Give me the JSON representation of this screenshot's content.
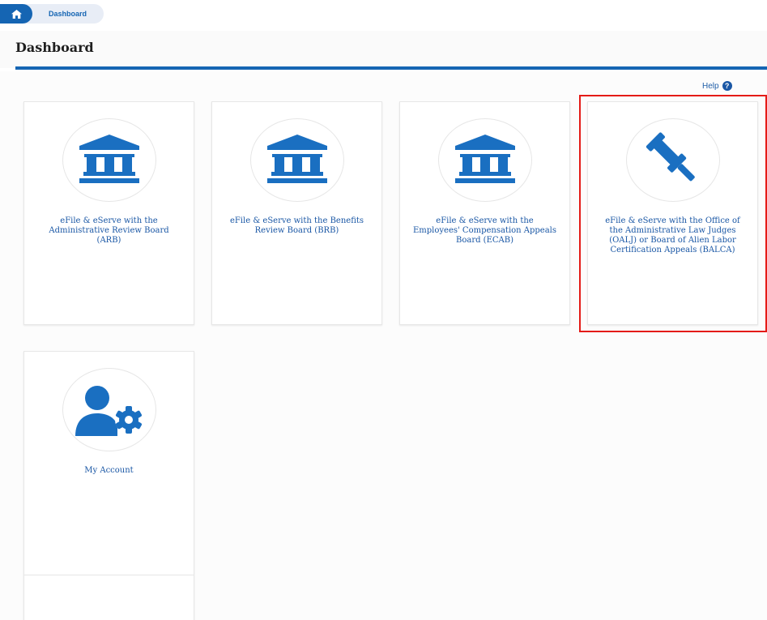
{
  "breadcrumb": {
    "home_icon": "home-icon",
    "current": "Dashboard"
  },
  "page": {
    "title": "Dashboard"
  },
  "help": {
    "label": "Help",
    "icon": "question-circle-icon",
    "glyph": "?"
  },
  "colors": {
    "accent": "#1565b3",
    "highlight": "#e41b17",
    "link": "#1a57a5"
  },
  "cards": [
    {
      "icon": "courthouse-icon",
      "label": "eFile & eServe with the Administrative Review Board (ARB)"
    },
    {
      "icon": "courthouse-icon",
      "label": "eFile & eServe with the Benefits Review Board (BRB)"
    },
    {
      "icon": "courthouse-icon",
      "label": "eFile & eServe with the Employees' Compensation Appeals Board (ECAB)"
    },
    {
      "icon": "gavel-icon",
      "label": "eFile & eServe with the Office of the Administrative Law Judges (OALJ) or Board of Alien Labor Certification Appeals (BALCA)",
      "highlighted": true
    },
    {
      "icon": "user-settings-icon",
      "label": "My Account"
    }
  ]
}
